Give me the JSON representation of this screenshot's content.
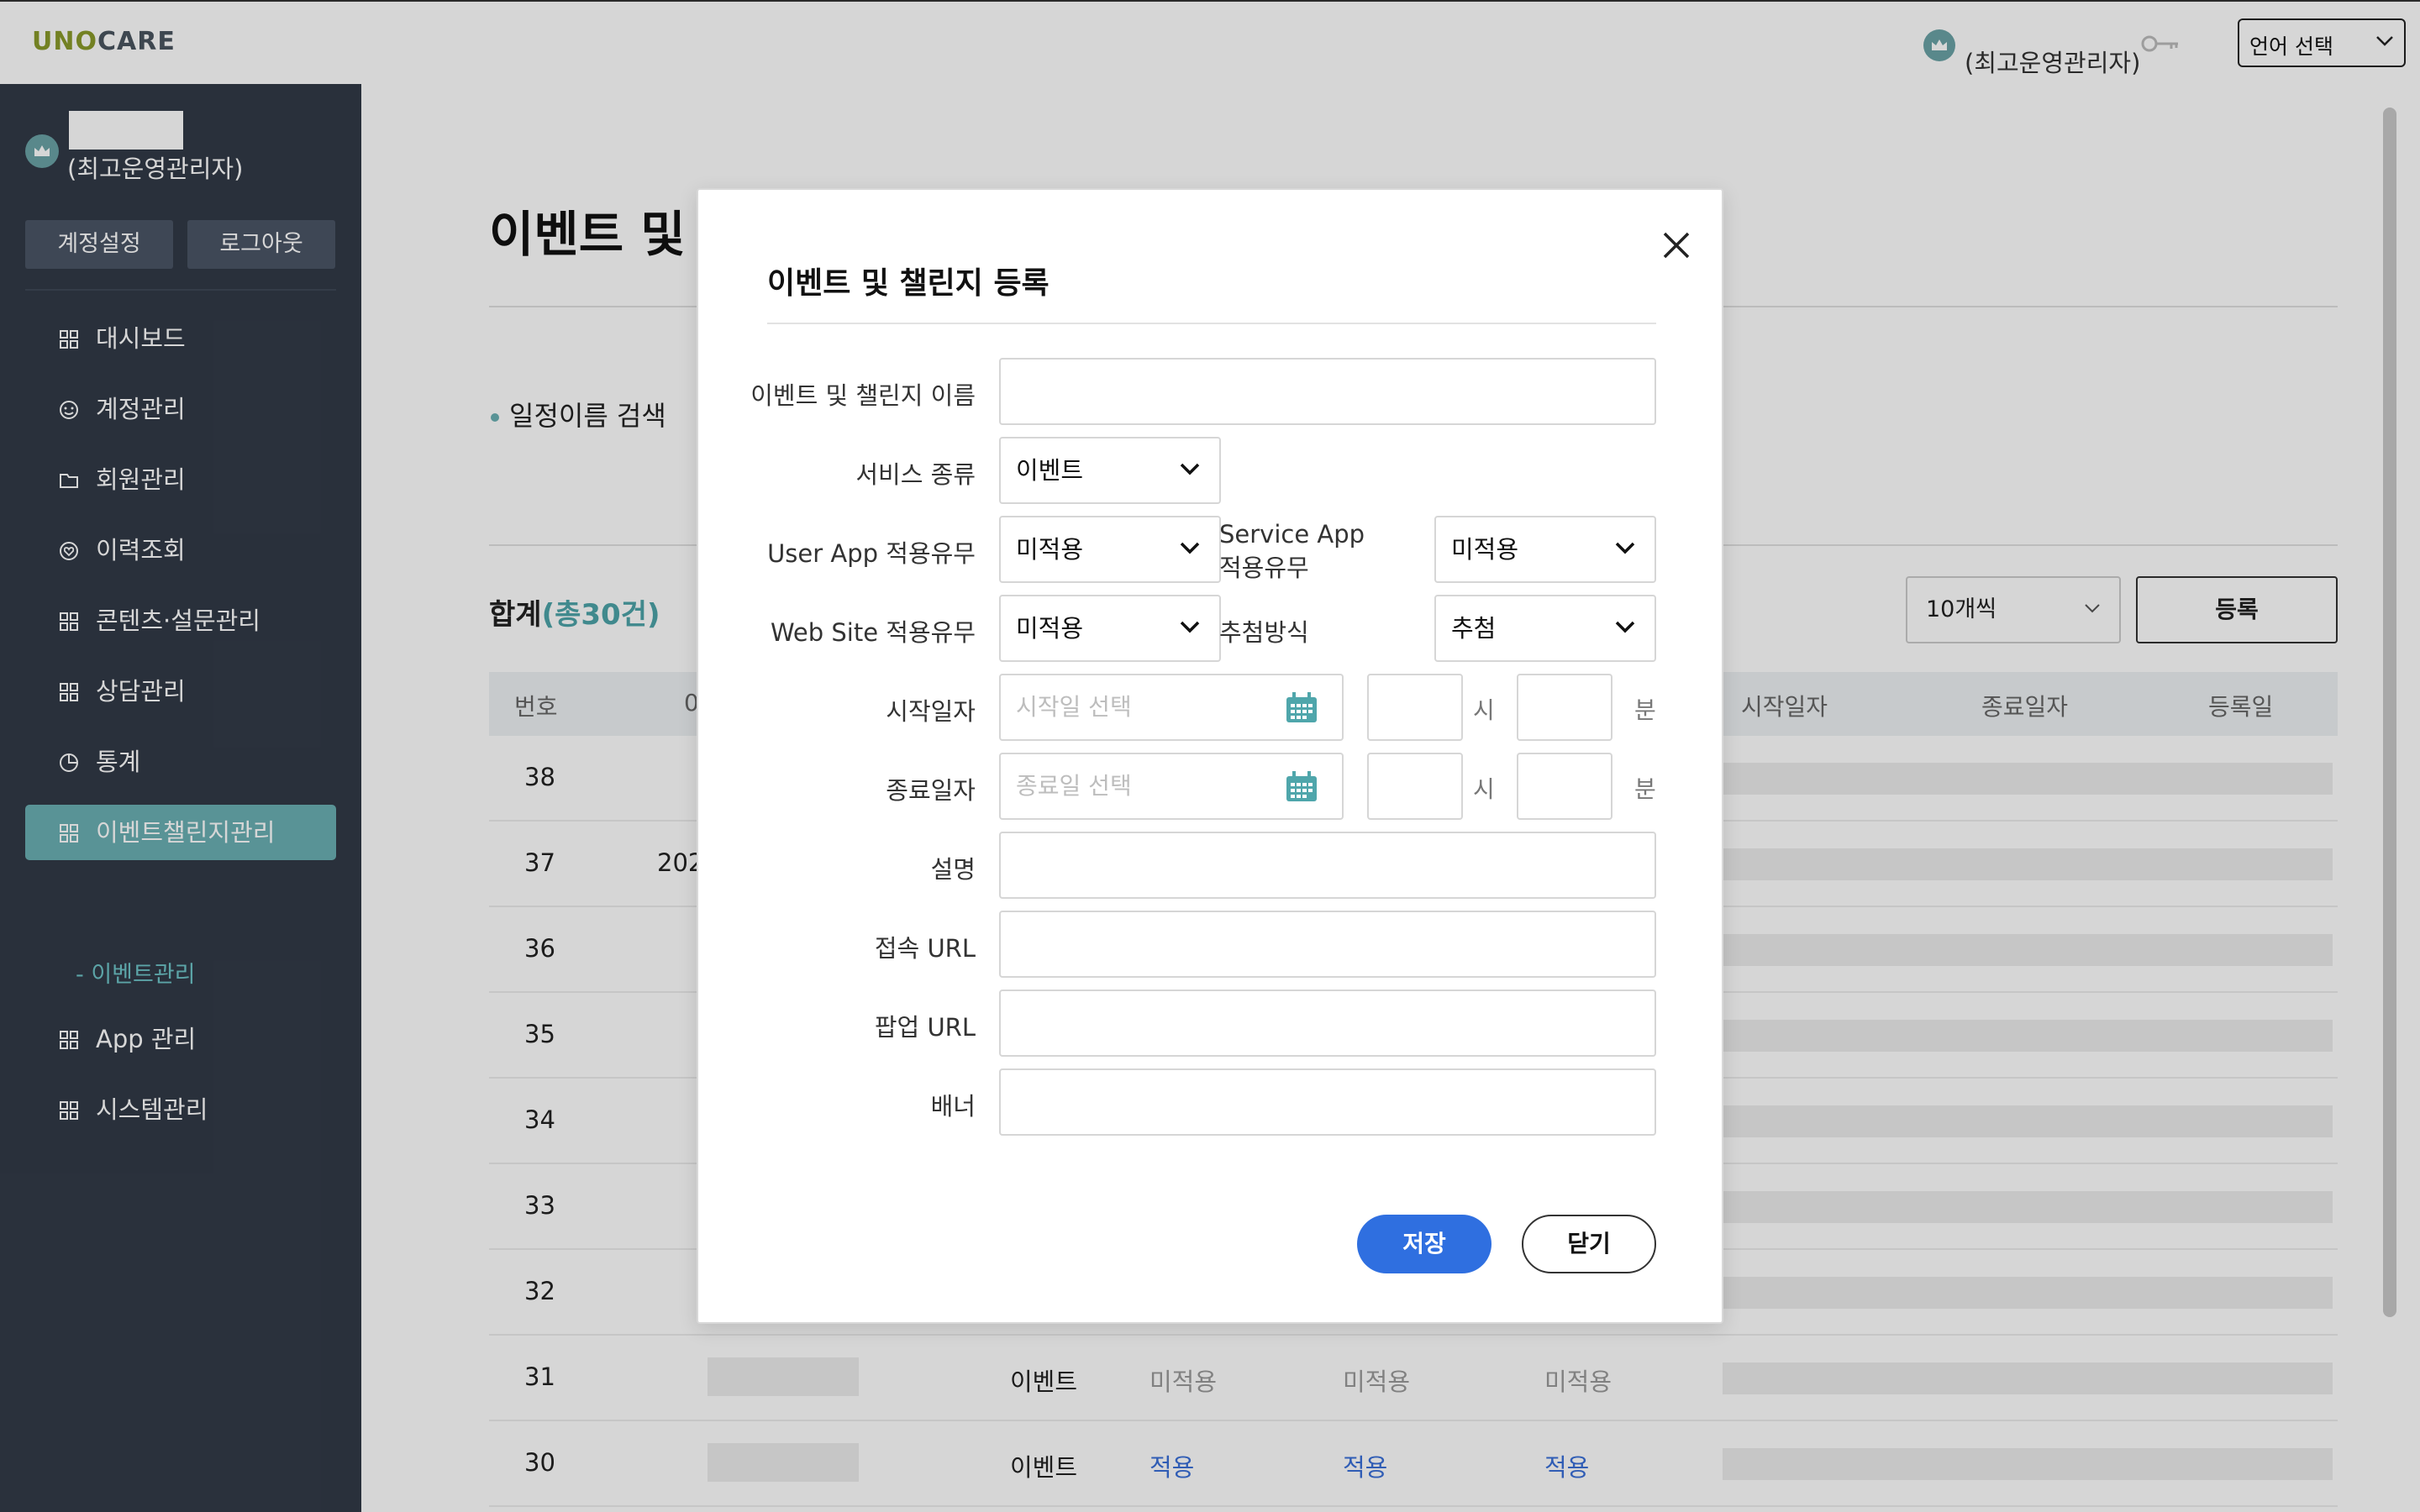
{
  "header": {
    "logo_part1": "UNO",
    "logo_part2": "CARE",
    "user_role": "(최고운영관리자)",
    "language_select": "언어 선택"
  },
  "sidebar": {
    "user_role": "(최고운영관리자)",
    "account_settings": "계정설정",
    "logout": "로그아웃",
    "items": [
      {
        "label": "대시보드",
        "icon": "grid-icon"
      },
      {
        "label": "계정관리",
        "icon": "face-icon"
      },
      {
        "label": "회원관리",
        "icon": "folder-icon"
      },
      {
        "label": "이력조회",
        "icon": "heart-icon"
      },
      {
        "label": "콘텐츠·설문관리",
        "icon": "grid-icon"
      },
      {
        "label": "상담관리",
        "icon": "grid-icon"
      },
      {
        "label": "통계",
        "icon": "chart-icon"
      },
      {
        "label": "이벤트챌린지관리",
        "icon": "grid-icon",
        "active": true
      },
      {
        "label": "App 관리",
        "icon": "grid-icon"
      },
      {
        "label": "시스템관리",
        "icon": "grid-icon"
      }
    ],
    "sub_item": "- 이벤트관리"
  },
  "main": {
    "page_title": "이벤트 및",
    "search_label": "일정이름 검색",
    "total_label": "합계",
    "total_count": "(총30건)",
    "per_page": "10개씩",
    "register_button": "등록",
    "columns": [
      "번호",
      "시작일자",
      "종료일자",
      "등록일"
    ],
    "column_partial": "0",
    "rows": [
      {
        "num": "38",
        "date": "",
        "svc": "",
        "c1": "",
        "c2": "",
        "c3": ""
      },
      {
        "num": "37",
        "date": "202",
        "svc": "",
        "c1": "",
        "c2": "",
        "c3": ""
      },
      {
        "num": "36",
        "date": "",
        "svc": "",
        "c1": "",
        "c2": "",
        "c3": ""
      },
      {
        "num": "35",
        "date": "",
        "svc": "",
        "c1": "",
        "c2": "",
        "c3": ""
      },
      {
        "num": "34",
        "date": "",
        "svc": "",
        "c1": "",
        "c2": "",
        "c3": ""
      },
      {
        "num": "33",
        "date": "",
        "svc": "",
        "c1": "",
        "c2": "",
        "c3": ""
      },
      {
        "num": "32",
        "date": "",
        "svc": "",
        "c1": "",
        "c2": "",
        "c3": ""
      },
      {
        "num": "31",
        "date": "",
        "svc": "이벤트",
        "c1": "미적용",
        "c2": "미적용",
        "c3": "미적용"
      },
      {
        "num": "30",
        "date": "",
        "svc": "이벤트",
        "c1": "적용",
        "c2": "적용",
        "c3": "적용"
      }
    ]
  },
  "modal": {
    "title": "이벤트 및 챌린지 등록",
    "labels": {
      "name": "이벤트 및 챌린지 이름",
      "service_type": "서비스 종류",
      "user_app": "User App 적용유무",
      "service_app_line1": "Service App",
      "service_app_line2": "적용유무",
      "web_site": "Web Site 적용유무",
      "draw_method": "추첨방식",
      "start_date": "시작일자",
      "end_date": "종료일자",
      "description": "설명",
      "access_url": "접속 URL",
      "popup_url": "팝업 URL",
      "banner": "배너"
    },
    "values": {
      "service_type": "이벤트",
      "user_app": "미적용",
      "service_app": "미적용",
      "web_site": "미적용",
      "draw_method": "추첨"
    },
    "placeholders": {
      "start_date": "시작일 선택",
      "end_date": "종료일 선택"
    },
    "units": {
      "hour": "시",
      "minute": "분"
    },
    "save_button": "저장",
    "close_button": "닫기"
  },
  "colors": {
    "sidebar_bg": "#323a47",
    "accent_teal": "#6ab0b3",
    "save_blue": "#2f6fe0",
    "applied_blue": "#3a6fd8"
  }
}
